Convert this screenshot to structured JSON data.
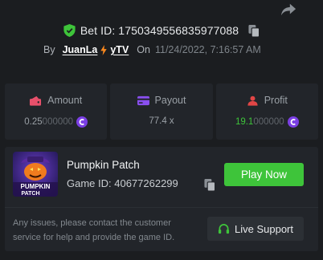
{
  "header": {
    "bet_id": "Bet ID: 1750349556835977088",
    "by_label": "By",
    "user_part1": "JuanLa",
    "user_part2": "yTV",
    "on_label": "On",
    "date": "11/24/2022, 7:16:57 AM"
  },
  "stats": {
    "amount": {
      "label": "Amount",
      "value_main": "0.25",
      "value_dim": "000000"
    },
    "payout": {
      "label": "Payout",
      "value": "77.4 x"
    },
    "profit": {
      "label": "Profit",
      "value_main": "19.1",
      "value_dim": "000000"
    }
  },
  "game": {
    "name": "Pumpkin Patch",
    "id": "Game ID: 40677262299",
    "thumb_title": "PUMPKIN",
    "thumb_subtitle": "PATCH",
    "play_label": "Play Now"
  },
  "support": {
    "help_text": "Any issues, please contact the customer service for help and provide the game ID.",
    "button_label": "Live Support"
  },
  "colors": {
    "accent_green": "#3ec43a",
    "coin_purple": "#7b3fe4",
    "amount_icon": "#e8506b",
    "payout_icon": "#8a4ff0",
    "profit_icon": "#e24646"
  },
  "icons": [
    "share-icon",
    "shield-check-icon",
    "copy-icon",
    "lightning-icon",
    "coin-icon",
    "wallet-icon",
    "card-icon",
    "user-icon",
    "headset-icon"
  ]
}
